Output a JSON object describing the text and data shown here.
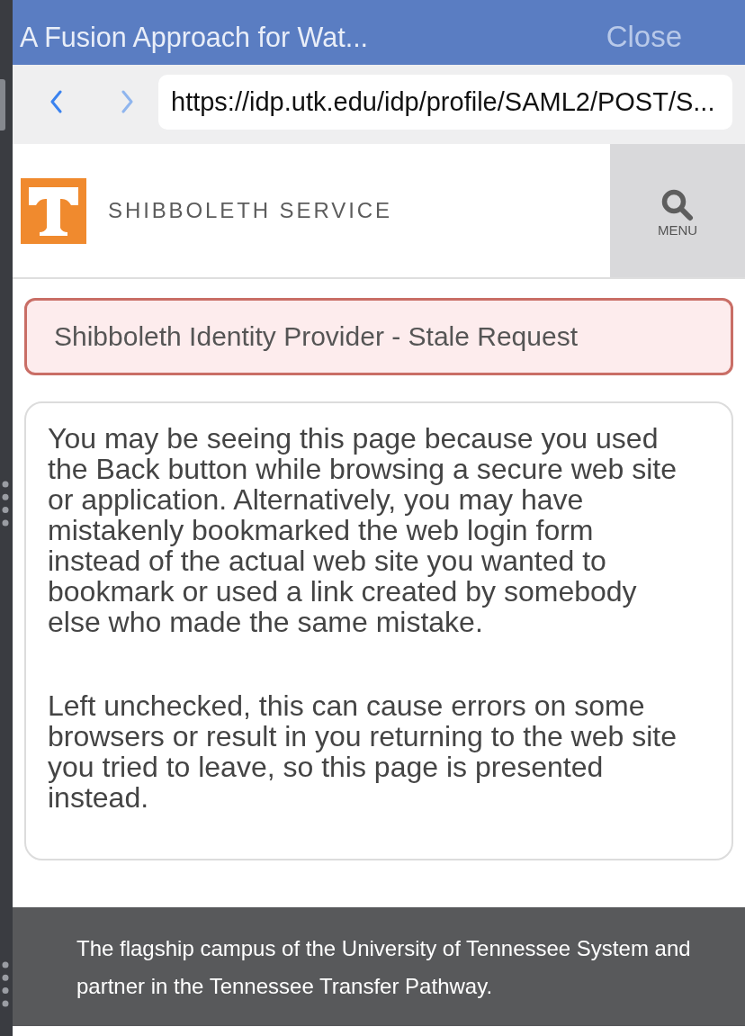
{
  "window": {
    "title": "A Fusion Approach for Wat...",
    "close": "Close"
  },
  "browser": {
    "nav_buttons": [
      {
        "kind": "back",
        "disabled": false
      },
      {
        "kind": "forward",
        "disabled": true
      }
    ],
    "url": "https://idp.utk.edu/idp/profile/SAML2/POST/S..."
  },
  "header": {
    "site_name": "SHIBBOLETH SERVICE",
    "menu": "MENU"
  },
  "alert": {
    "text": "Shibboleth Identity Provider - Stale Request"
  },
  "message": {
    "paragraphs": [
      "You may be seeing this page because you used the Back button while browsing a secure web site or application. Alternatively, you may have mistakenly bookmarked the web login form instead of the actual web site you wanted to bookmark or used a link created by somebody else who made the same mistake.",
      "Left unchecked, this can cause errors on some browsers or result in you returning to the web site you tried to leave, so this page is presented instead."
    ]
  },
  "footer": {
    "text": "The flagship campus of the University of Tennessee System and partner in the Tennessee Transfer Pathway."
  }
}
